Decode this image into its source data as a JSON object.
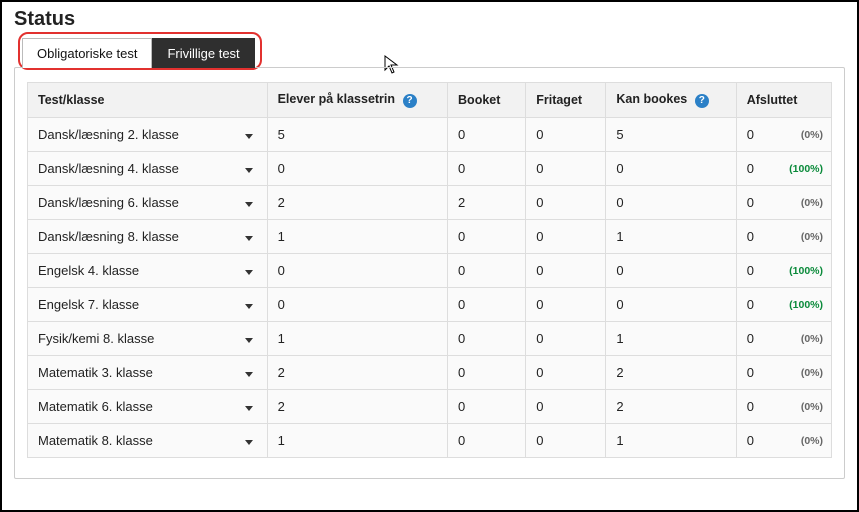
{
  "title": "Status",
  "tabs": {
    "active": "Obligatoriske test",
    "inactive": "Frivillige test"
  },
  "columns": {
    "name": "Test/klasse",
    "elever": "Elever på klassetrin",
    "booket": "Booket",
    "fritaget": "Fritaget",
    "kan": "Kan bookes",
    "afsluttet": "Afsluttet"
  },
  "rows": [
    {
      "name": "Dansk/læsning 2. klasse",
      "elever": "5",
      "booket": "0",
      "fritaget": "0",
      "kan": "5",
      "afsluttet": "0",
      "pct": "(0%)",
      "pct_cls": "gray"
    },
    {
      "name": "Dansk/læsning 4. klasse",
      "elever": "0",
      "booket": "0",
      "fritaget": "0",
      "kan": "0",
      "afsluttet": "0",
      "pct": "(100%)",
      "pct_cls": "green"
    },
    {
      "name": "Dansk/læsning 6. klasse",
      "elever": "2",
      "booket": "2",
      "fritaget": "0",
      "kan": "0",
      "afsluttet": "0",
      "pct": "(0%)",
      "pct_cls": "gray"
    },
    {
      "name": "Dansk/læsning 8. klasse",
      "elever": "1",
      "booket": "0",
      "fritaget": "0",
      "kan": "1",
      "afsluttet": "0",
      "pct": "(0%)",
      "pct_cls": "gray"
    },
    {
      "name": "Engelsk 4. klasse",
      "elever": "0",
      "booket": "0",
      "fritaget": "0",
      "kan": "0",
      "afsluttet": "0",
      "pct": "(100%)",
      "pct_cls": "green"
    },
    {
      "name": "Engelsk 7. klasse",
      "elever": "0",
      "booket": "0",
      "fritaget": "0",
      "kan": "0",
      "afsluttet": "0",
      "pct": "(100%)",
      "pct_cls": "green"
    },
    {
      "name": "Fysik/kemi 8. klasse",
      "elever": "1",
      "booket": "0",
      "fritaget": "0",
      "kan": "1",
      "afsluttet": "0",
      "pct": "(0%)",
      "pct_cls": "gray"
    },
    {
      "name": "Matematik 3. klasse",
      "elever": "2",
      "booket": "0",
      "fritaget": "0",
      "kan": "2",
      "afsluttet": "0",
      "pct": "(0%)",
      "pct_cls": "gray"
    },
    {
      "name": "Matematik 6. klasse",
      "elever": "2",
      "booket": "0",
      "fritaget": "0",
      "kan": "2",
      "afsluttet": "0",
      "pct": "(0%)",
      "pct_cls": "gray"
    },
    {
      "name": "Matematik 8. klasse",
      "elever": "1",
      "booket": "0",
      "fritaget": "0",
      "kan": "1",
      "afsluttet": "0",
      "pct": "(0%)",
      "pct_cls": "gray"
    }
  ],
  "col_widths": {
    "name": "239",
    "elever": "180",
    "booket": "78",
    "fritaget": "80",
    "kan": "130",
    "afsluttet": "95"
  }
}
